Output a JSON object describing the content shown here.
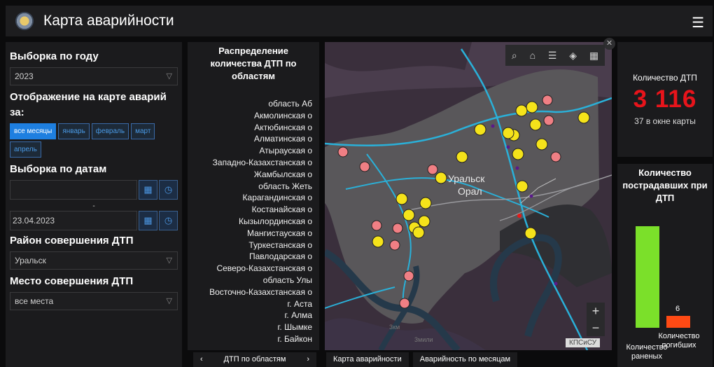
{
  "header": {
    "title": "Карта аварийности"
  },
  "filters": {
    "year_label": "Выборка по году",
    "year_value": "2023",
    "display_label": "Отображение на карте аварий за:",
    "months": [
      "все месяцы",
      "январь",
      "февраль",
      "март",
      "апрель"
    ],
    "active_month": "все месяцы",
    "dates_label": "Выборка по датам",
    "date_from": "",
    "date_separator": "-",
    "date_to": "23.04.2023",
    "district_label": "Район совершения ДТП",
    "district_value": "Уральск",
    "place_label": "Место совершения ДТП",
    "place_value": "все места"
  },
  "regions_panel": {
    "title": "Распределение количества ДТП по областям",
    "regions": [
      "область Аб",
      "Акмолинская о",
      "Актюбинская о",
      "Алматинская о",
      "Атырауская о",
      "Западно-Казахстанская о",
      "Жамбылская о",
      "область Жеть",
      "Карагандинская о",
      "Костанайская о",
      "Кызылординская о",
      "Мангистауская о",
      "Туркестанская о",
      "Павлодарская о",
      "Северо-Казахстанская о",
      "область Улы",
      "Восточно-Казахстанская о",
      "г. Аста",
      "г. Алма",
      "г. Шымке",
      "г. Байкон"
    ]
  },
  "tabs": {
    "regions_tab": "ДТП по областям",
    "prev": "‹",
    "next": "›",
    "map_tab": "Карта аварийности",
    "months_tab": "Аварийность по месяцам"
  },
  "map": {
    "city_label_1": "Уральск",
    "city_label_2": "Орал",
    "scale_1": "3км",
    "scale_2": "3мили",
    "attribution": "КПСиСУ",
    "zoom_in": "+",
    "zoom_out": "−",
    "tools": [
      "search-icon",
      "home-icon",
      "list-icon",
      "layers-icon",
      "grid-icon"
    ]
  },
  "kpi": {
    "label": "Количество ДТП",
    "value": "3 116",
    "sub": "37 в окне карты"
  },
  "injuries": {
    "title": "Количество пострадавших при ДТП",
    "chart_data": {
      "type": "bar",
      "categories": [
        "Количество раненых",
        "Количество погибших"
      ],
      "values": [
        52,
        6
      ],
      "data_labels": [
        "",
        "6"
      ],
      "colors": [
        "#7be02a",
        "#ff4a14"
      ]
    }
  },
  "colors": {
    "accent": "#1e7fe0",
    "kpi_red": "#e8141b",
    "marker_yellow": "#f5e31a",
    "marker_red": "#f07f84",
    "road_cyan": "#2ab0d8"
  }
}
